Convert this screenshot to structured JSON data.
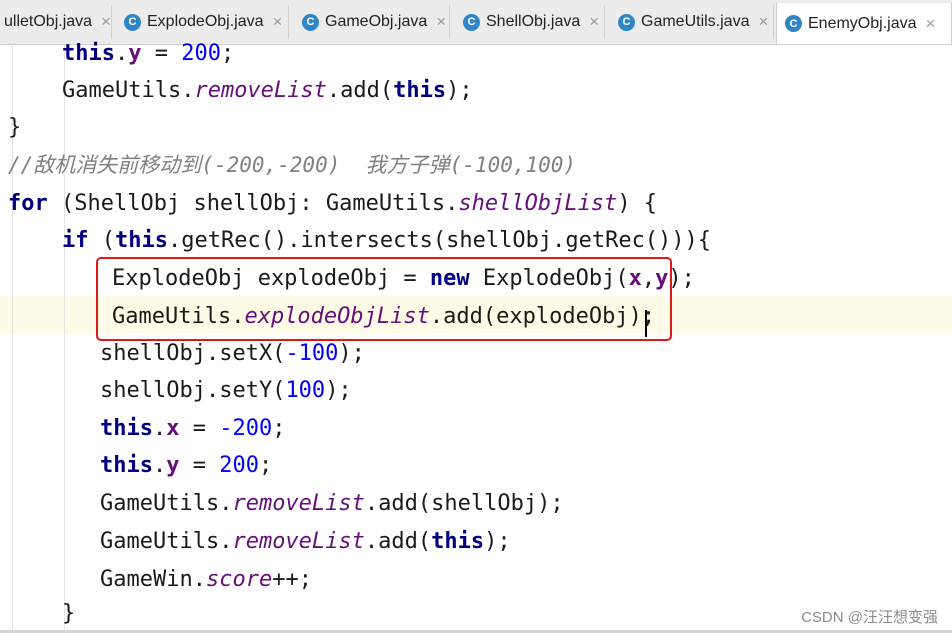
{
  "tabs": [
    {
      "label": "ulletObj.java",
      "active": false,
      "icon": "class-icon"
    },
    {
      "label": "ExplodeObj.java",
      "active": false,
      "icon": "class-icon"
    },
    {
      "label": "GameObj.java",
      "active": false,
      "icon": "class-icon"
    },
    {
      "label": "ShellObj.java",
      "active": false,
      "icon": "class-icon"
    },
    {
      "label": "GameUtils.java",
      "active": false,
      "icon": "class-icon"
    },
    {
      "label": "EnemyObj.java",
      "active": true,
      "icon": "class-icon"
    }
  ],
  "tab_icon_glyph": "C",
  "tab_close_glyph": "×",
  "code": {
    "l1": {
      "kw": "this",
      "dot": ".",
      "fld": "y",
      "op": " = ",
      "num": "200",
      "end": ";"
    },
    "l2": {
      "cls": "GameUtils.",
      "st": "removeList",
      "call": ".add(",
      "kw": "this",
      "end": ");"
    },
    "l3": "}",
    "l4": "//敌机消失前移动到(-200,-200)  我方子弹(-100,100)",
    "l5": {
      "kw": "for",
      "a": " (ShellObj shellObj: GameUtils.",
      "st": "shellObjList",
      "b": ") {"
    },
    "l6": {
      "kw1": "if",
      "a": " (",
      "kw2": "this",
      "b": ".getRec().intersects(shellObj.getRec())){"
    },
    "l7": {
      "a": "ExplodeObj explodeObj = ",
      "kw": "new",
      "b": " ExplodeObj(",
      "f1": "x",
      "comma": ",",
      "f2": "y",
      "end": ");"
    },
    "l8": {
      "cls": "GameUtils.",
      "st": "explodeObjList",
      "call": ".add(explodeObj);"
    },
    "l9": {
      "a": "shellObj.setX(",
      "num": "-100",
      "end": ");"
    },
    "l10": {
      "a": "shellObj.setY(",
      "num": "100",
      "end": ");"
    },
    "l11": {
      "kw": "this",
      "dot": ".",
      "fld": "x",
      "op": " = ",
      "num": "-200",
      "end": ";"
    },
    "l12": {
      "kw": "this",
      "dot": ".",
      "fld": "y",
      "op": " = ",
      "num": "200",
      "end": ";"
    },
    "l13": {
      "cls": "GameUtils.",
      "st": "removeList",
      "call": ".add(shellObj);"
    },
    "l14": {
      "cls": "GameUtils.",
      "st": "removeList",
      "call": ".add(",
      "kw": "this",
      "end": ");"
    },
    "l15": {
      "cls": "GameWin.",
      "st": "score",
      "end": "++;"
    },
    "l16": "}"
  },
  "watermark": "CSDN @汪汪想变强",
  "colors": {
    "keyword": "#000080",
    "static_field": "#660e7a",
    "number": "#0000ff",
    "comment": "#808080",
    "highlight_box": "#e01818",
    "caret_line": "#fdfbe6"
  }
}
